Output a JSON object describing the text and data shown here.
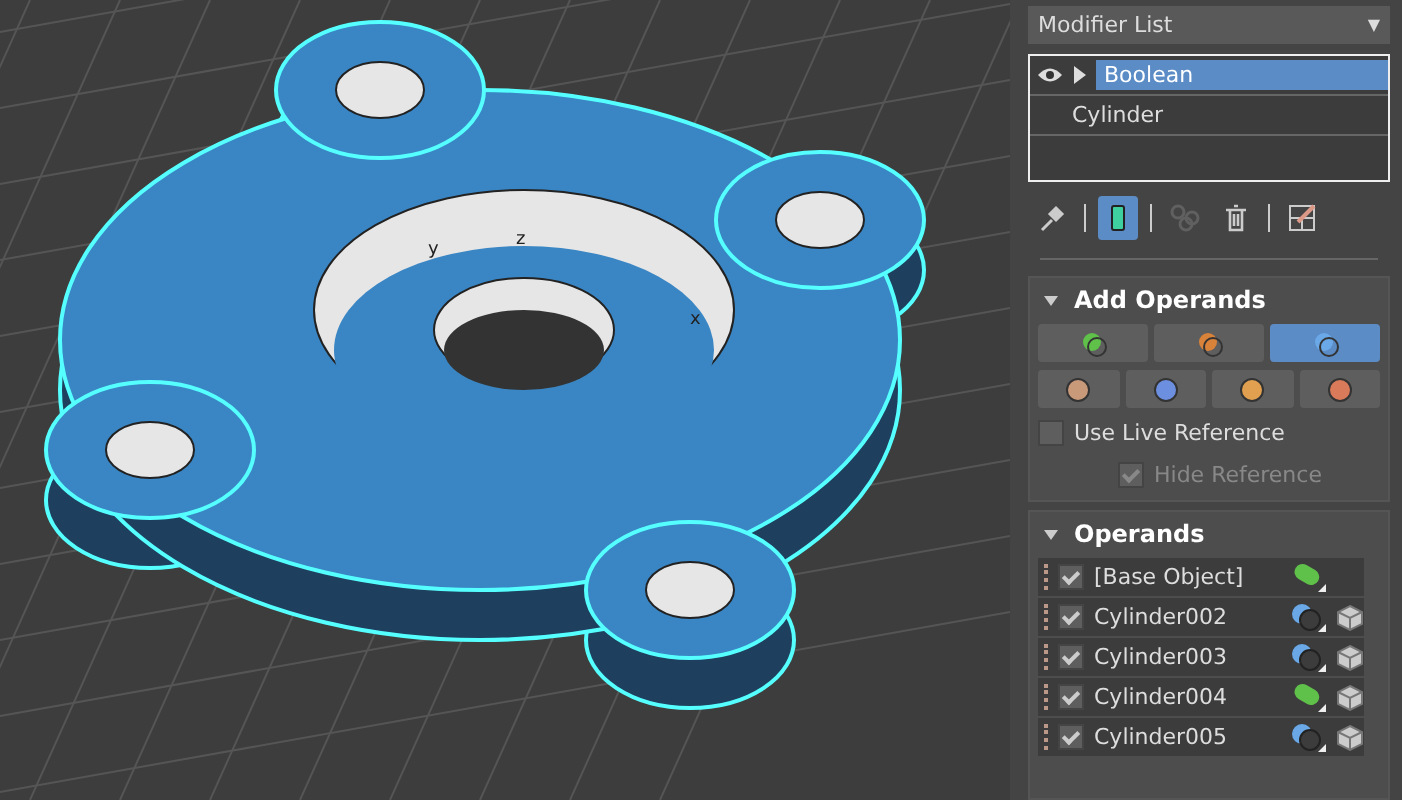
{
  "viewport": {
    "gizmo": [
      "y",
      "z",
      "x"
    ]
  },
  "modifier_list": {
    "label": "Modifier List",
    "caret": "▼"
  },
  "stack": [
    {
      "label": "Boolean",
      "selected": true,
      "visible": true,
      "expandable": true
    },
    {
      "label": "Cylinder",
      "selected": false,
      "visible": false,
      "expandable": false
    }
  ],
  "toolbar": [
    {
      "kind": "pin",
      "selected": false,
      "disabled": false
    },
    {
      "kind": "sep"
    },
    {
      "kind": "end-result",
      "selected": true,
      "disabled": false
    },
    {
      "kind": "sep"
    },
    {
      "kind": "unique",
      "selected": false,
      "disabled": true
    },
    {
      "kind": "trash",
      "selected": false,
      "disabled": false
    },
    {
      "kind": "sep"
    },
    {
      "kind": "configure",
      "selected": false,
      "disabled": false
    }
  ],
  "add_operands": {
    "title": "Add Operands",
    "expanded": true,
    "row_1": [
      {
        "kind": "union",
        "selected": false
      },
      {
        "kind": "intersect",
        "selected": false
      },
      {
        "kind": "subtract",
        "selected": true
      }
    ],
    "row_2": [
      {
        "kind": "merge",
        "selected": false
      },
      {
        "kind": "attach",
        "selected": false
      },
      {
        "kind": "insert",
        "selected": false
      },
      {
        "kind": "split",
        "selected": false
      }
    ],
    "use_live_reference": {
      "label": "Use Live Reference",
      "checked": false,
      "disabled": false
    },
    "hide_reference": {
      "label": "Hide Reference",
      "checked": true,
      "disabled": true
    }
  },
  "operands": {
    "title": "Operands",
    "expanded": true,
    "items": [
      {
        "name": "[Base Object]",
        "checked": true,
        "kind": "union",
        "instance": false
      },
      {
        "name": "Cylinder002",
        "checked": true,
        "kind": "subtract",
        "instance": true
      },
      {
        "name": "Cylinder003",
        "checked": true,
        "kind": "subtract",
        "instance": true
      },
      {
        "name": "Cylinder004",
        "checked": true,
        "kind": "union",
        "instance": true
      },
      {
        "name": "Cylinder005",
        "checked": true,
        "kind": "subtract",
        "instance": true
      }
    ]
  }
}
